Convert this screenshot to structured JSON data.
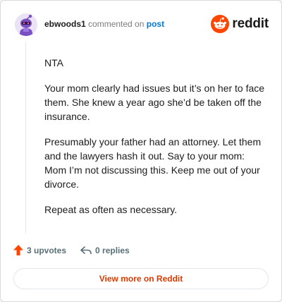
{
  "header": {
    "username": "ebwoods1",
    "commented_text": "commented on",
    "post_link": "post",
    "brand": "reddit"
  },
  "comment": {
    "paragraphs": [
      "NTA",
      "Your mom clearly had issues but it’s on her to face them. She knew a year ago she’d be taken off the insurance.",
      "Presumably your father had an attorney. Let them and the lawyers hash it out. Say to your mom: Mom I’m not discussing this. Keep me out of your divorce.",
      "Repeat as often as necessary."
    ]
  },
  "actions": {
    "upvotes": "3 upvotes",
    "replies": "0 replies"
  },
  "footer": {
    "view_more": "View more on Reddit"
  },
  "colors": {
    "brand_orange": "#ff4500",
    "link_blue": "#0079d3",
    "view_more_text": "#d93a00"
  }
}
